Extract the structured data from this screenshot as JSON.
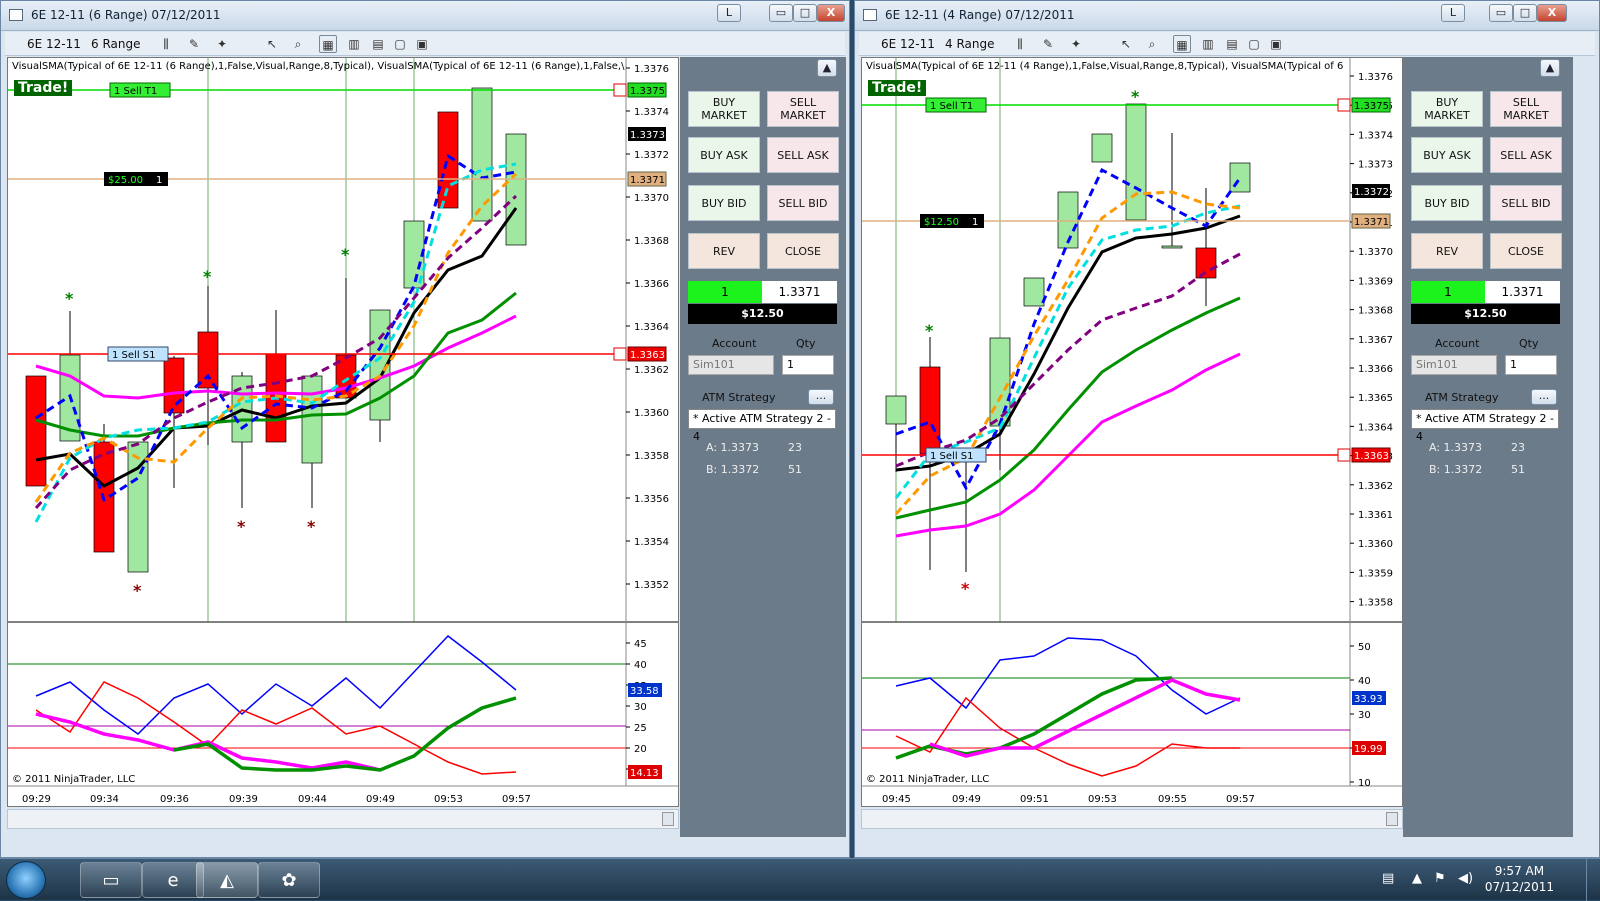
{
  "windows": [
    {
      "title": "6E 12-11 (6 Range)  07/12/2011",
      "instrument": "6E 12-11",
      "period": "6 Range",
      "indicator_text": "VisualSMA(Typical of 6E 12-11 (6 Range),1,False,Visual,Range,8,Typical), VisualSMA(Typical of 6E 12-11 (6 Range),1,False,\\",
      "trade_badge": "Trade!",
      "copyright": "© 2011 NinjaTrader, LLC",
      "price_ticks": [
        "1.3376",
        "1.3374",
        "1.3372",
        "1.3370",
        "1.3368",
        "1.3366",
        "1.3364",
        "1.3362",
        "1.3360",
        "1.3358",
        "1.3356",
        "1.3354",
        "1.3352"
      ],
      "osc_ticks": [
        "45",
        "40",
        "35",
        "30",
        "25",
        "20",
        "15"
      ],
      "time_labels": [
        "09:29",
        "09:34",
        "09:36",
        "09:39",
        "09:44",
        "09:49",
        "09:53",
        "09:57"
      ],
      "orders": {
        "target_label": "1  Sell T1",
        "target_price": "1.3375",
        "stop_label": "1  Sell S1",
        "stop_price": "1.3363",
        "entry_pnl": "$25.00",
        "entry_qty": "1",
        "entry_price": "1.3371",
        "last_price": "1.3373"
      },
      "osc_markers": {
        "blue": "33.58",
        "red": "14.13"
      }
    },
    {
      "title": "6E 12-11 (4 Range)  07/12/2011",
      "instrument": "6E 12-11",
      "period": "4 Range",
      "indicator_text": "VisualSMA(Typical of 6E 12-11 (4 Range),1,False,Visual,Range,8,Typical), VisualSMA(Typical of 6",
      "trade_badge": "Trade!",
      "copyright": "© 2011 NinjaTrader, LLC",
      "price_ticks": [
        "1.3376",
        "1.3375",
        "1.3374",
        "1.3373",
        "1.3372",
        "1.3371",
        "1.3370",
        "1.3369",
        "1.3368",
        "1.3367",
        "1.3366",
        "1.3365",
        "1.3364",
        "1.3363",
        "1.3362",
        "1.3361",
        "1.3360",
        "1.3359",
        "1.3358"
      ],
      "osc_ticks": [
        "50",
        "40",
        "30",
        "20",
        "10"
      ],
      "time_labels": [
        "09:45",
        "09:49",
        "09:51",
        "09:53",
        "09:55",
        "09:57"
      ],
      "orders": {
        "target_label": "1  Sell T1",
        "target_price": "1.3375",
        "stop_label": "1  Sell S1",
        "stop_price": "1.3363",
        "entry_pnl": "$12.50",
        "entry_qty": "1",
        "entry_price": "1.3371",
        "last_price": "1.3372"
      },
      "osc_markers": {
        "blue": "33.93",
        "red": "19.99"
      }
    }
  ],
  "panel": {
    "buy_market": "BUY MARKET",
    "sell_market": "SELL MARKET",
    "buy_ask": "BUY ASK",
    "sell_ask": "SELL ASK",
    "buy_bid": "BUY BID",
    "sell_bid": "SELL BID",
    "rev": "REV",
    "close": "CLOSE",
    "position_qty": "1",
    "position_price": "1.3371",
    "pnl": "$12.50",
    "account_label": "Account",
    "qty_label": "Qty",
    "account": "Sim101",
    "qty": "1",
    "atm_label": "ATM Strategy",
    "atm_value": "* Active ATM Strategy 2 - 4",
    "ask_label": "A: 1.3373",
    "ask_size": "23",
    "bid_label": "B: 1.3372",
    "bid_size": "51"
  },
  "titlebar_buttons": {
    "l": "L",
    "min": "▭",
    "max": "□",
    "close": "X"
  },
  "taskbar": {
    "time": "9:57 AM",
    "date": "07/12/2011"
  },
  "colors": {
    "up": "#a0e8a0",
    "down": "#ff0000",
    "target": "#00dd00",
    "stop": "#ff0000",
    "entry": "#e0b080"
  }
}
